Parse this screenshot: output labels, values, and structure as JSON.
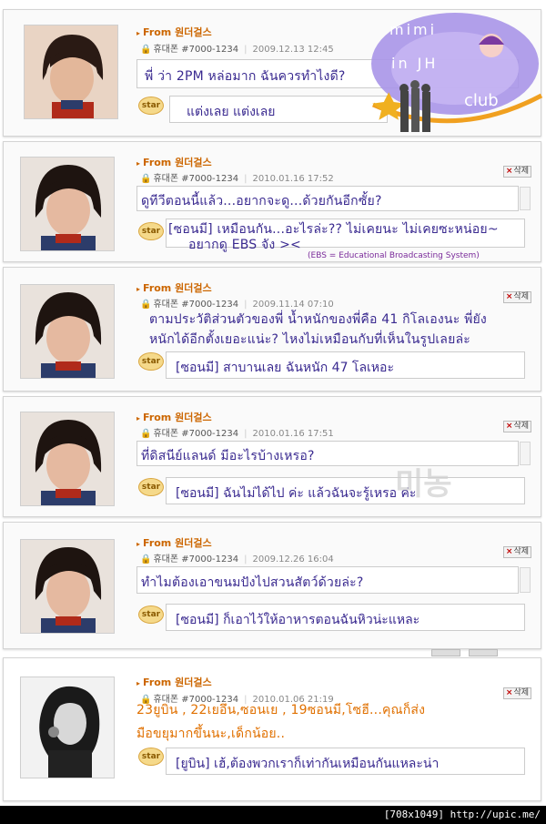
{
  "logo": {
    "top_text": "mimi",
    "mid_text": "in JH",
    "club_text": "club"
  },
  "watermark": "미농",
  "common": {
    "from_label": "From 원더걸스",
    "device_label": "휴대폰 #7000-1234",
    "delete_label": "삭제",
    "star_label": "star"
  },
  "posts": [
    {
      "date": "2009.12.13 12:45",
      "message_lines": [
        "พี่ ว่า 2PM หล่อมาก ฉันควรทำไงดี?"
      ],
      "reply_lines": [
        "แต่งเลย แต่งเลย"
      ],
      "has_delete": false
    },
    {
      "date": "2010.01.16 17:52",
      "message_lines": [
        "ดูทีวีตอนนี้แล้ว...อยากจะดู...ด้วยกันอีกซั้ย?"
      ],
      "reply_lines": [
        "[ซอนมี] เหมือนกัน...อะไรล่ะ?? ไม่เคยนะ ไม่เคยซะหน่อย~",
        "อยากดู EBS จัง ><"
      ],
      "note": "(EBS = Educational Broadcasting System)",
      "has_delete": true
    },
    {
      "date": "2009.11.14 07:10",
      "message_lines": [
        "ตามประวัติส่วนตัวของพี่ น้ำหนักของพี่คือ 41 กิโลเองนะ พี่ยัง",
        "หนักได้อีกตั้งเยอะแน่ะ? ไหงไม่เหมือนกับที่เห็นในรูปเลยล่ะ"
      ],
      "reply_lines": [
        "[ซอนมี] สาบานเลย ฉันหนัก 47 โลเหอะ"
      ],
      "has_delete": true
    },
    {
      "date": "2010.01.16 17:51",
      "message_lines": [
        "ที่ดิสนีย์แลนด์ มีอะไรบ้างเหรอ?"
      ],
      "reply_lines": [
        "[ซอนมี] ฉันไม่ได้ไป ค่ะ แล้วฉันจะรู้เหรอ ค่ะ"
      ],
      "has_delete": true
    },
    {
      "date": "2009.12.26 16:04",
      "message_lines": [
        "ทำไมต้องเอาขนมปังไปสวนสัตว์ด้วยล่ะ?"
      ],
      "reply_lines": [
        "[ซอนมี] ก็เอาไว้ให้อาหารตอนฉันหิวน่ะแหละ"
      ],
      "has_delete": true
    },
    {
      "date": "2010.01.06 21:19",
      "message_lines": [
        "23ยูบิน , 22เยอึน,ซอนเย , 19ซอนมี,โซฮี...คุณก็ส่ง",
        "มือขยุมากขึ้นนะ,เด็กน้อย.."
      ],
      "reply_lines": [
        "[ยูบิน] เฮ้,ต้องพวกเราก็เท่ากันเหมือนกันแหละน่า"
      ],
      "has_delete": true
    }
  ],
  "footer": {
    "text": "[708x1049] http://upic.me/"
  },
  "colors": {
    "from": "#cc6600",
    "hand": "#3a2a90",
    "orange": "#e07000"
  }
}
